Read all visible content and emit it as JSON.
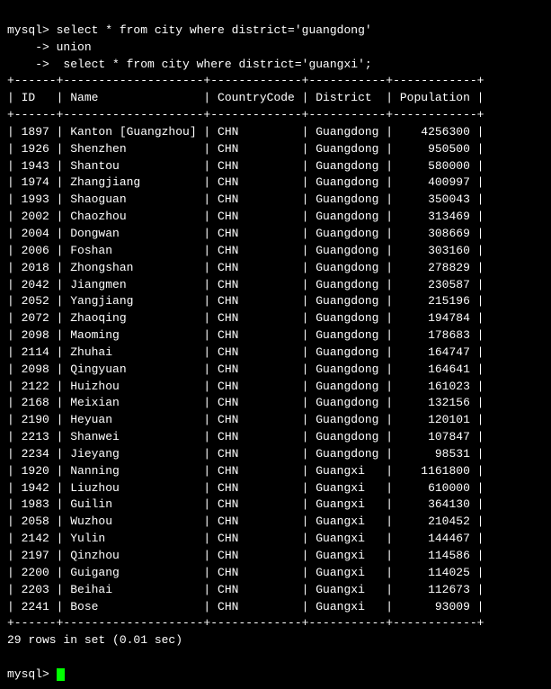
{
  "terminal": {
    "prompt_label": "mysql>",
    "command_line1": " select * from city where district='guangdong'",
    "command_line2": "    -> union",
    "command_line3": "    ->  select * from city where district='guangxi';",
    "separator1": "+------+--------------------+-------------+-----------+------------+",
    "header": "| ID   | Name               | CountryCode | District  | Population |",
    "separator2": "+------+--------------------+-------------+-----------+------------+",
    "rows": [
      "| 1897 | Kanton [Guangzhou] | CHN         | Guangdong |    4256300 |",
      "| 1926 | Shenzhen           | CHN         | Guangdong |     950500 |",
      "| 1943 | Shantou            | CHN         | Guangdong |     580000 |",
      "| 1974 | Zhangjiang         | CHN         | Guangdong |     400997 |",
      "| 1993 | Shaoguan           | CHN         | Guangdong |     350043 |",
      "| 2002 | Chaozhou           | CHN         | Guangdong |     313469 |",
      "| 2004 | Dongwan            | CHN         | Guangdong |     308669 |",
      "| 2006 | Foshan             | CHN         | Guangdong |     303160 |",
      "| 2018 | Zhongshan          | CHN         | Guangdong |     278829 |",
      "| 2042 | Jiangmen           | CHN         | Guangdong |     230587 |",
      "| 2052 | Yangjiang          | CHN         | Guangdong |     215196 |",
      "| 2072 | Zhaoqing           | CHN         | Guangdong |     194784 |",
      "| 2098 | Maoming            | CHN         | Guangdong |     178683 |",
      "| 2114 | Zhuhai             | CHN         | Guangdong |     164747 |",
      "| 2098 | Qingyuan           | CHN         | Guangdong |     164641 |",
      "| 2122 | Huizhou            | CHN         | Guangdong |     161023 |",
      "| 2168 | Meixian            | CHN         | Guangdong |     132156 |",
      "| 2190 | Heyuan             | CHN         | Guangdong |     120101 |",
      "| 2213 | Shanwei            | CHN         | Guangdong |     107847 |",
      "| 2234 | Jieyang            | CHN         | Guangdong |      98531 |",
      "| 1920 | Nanning            | CHN         | Guangxi   |    1161800 |",
      "| 1942 | Liuzhou            | CHN         | Guangxi   |     610000 |",
      "| 1983 | Guilin             | CHN         | Guangxi   |     364130 |",
      "| 2058 | Wuzhou             | CHN         | Guangxi   |     210452 |",
      "| 2142 | Yulin              | CHN         | Guangxi   |     144467 |",
      "| 2197 | Qinzhou            | CHN         | Guangxi   |     114586 |",
      "| 2200 | Guigang            | CHN         | Guangxi   |     114025 |",
      "| 2203 | Beihai             | CHN         | Guangxi   |     112673 |",
      "| 2241 | Bose               | CHN         | Guangxi   |      93009 |"
    ],
    "separator3": "+------+--------------------+-------------+-----------+------------+",
    "summary": "29 rows in set (0.01 sec)",
    "final_prompt": "mysql> "
  }
}
